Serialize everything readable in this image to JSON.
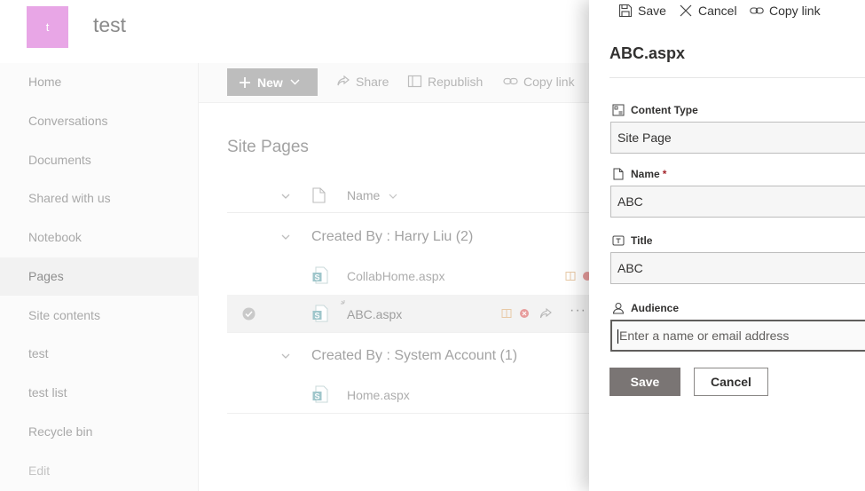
{
  "site": {
    "logo_letter": "t",
    "title": "test"
  },
  "nav": {
    "items": [
      "Home",
      "Conversations",
      "Documents",
      "Shared with us",
      "Notebook",
      "Pages",
      "Site contents",
      "test",
      "test list",
      "Recycle bin",
      "Edit"
    ],
    "active": "Pages"
  },
  "commandbar": {
    "new_label": "New",
    "share_label": "Share",
    "republish_label": "Republish",
    "copy_link_label": "Copy link"
  },
  "library": {
    "title": "Site Pages",
    "name_column": "Name",
    "groups": [
      {
        "label": "Created By : Harry Liu (2)",
        "files": [
          "CollabHome.aspx",
          "ABC.aspx"
        ]
      },
      {
        "label": "Created By : System Account (1)",
        "files": [
          "Home.aspx"
        ]
      }
    ]
  },
  "panel": {
    "save_label": "Save",
    "cancel_label": "Cancel",
    "copy_link_label": "Copy link",
    "title": "ABC.aspx",
    "fields": {
      "content_type": {
        "label": "Content Type",
        "value": "Site Page"
      },
      "name": {
        "label": "Name",
        "required_mark": "*",
        "value": "ABC"
      },
      "title": {
        "label": "Title",
        "value": "ABC"
      },
      "audience": {
        "label": "Audience",
        "placeholder": "Enter a name or email address"
      }
    },
    "save_button": "Save",
    "cancel_button": "Cancel"
  },
  "colors": {
    "logo": "#e8a6e6",
    "primary_button": "#7a7574",
    "required": "#a4262c"
  }
}
